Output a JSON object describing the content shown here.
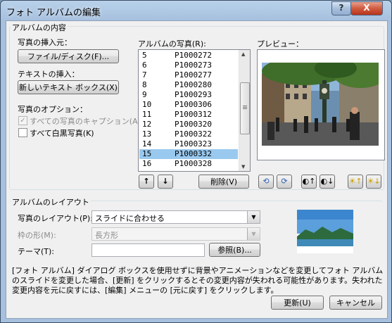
{
  "window": {
    "title": "フォト アルバムの編集",
    "help_label": "?",
    "close_label": "X"
  },
  "album_content": {
    "group_label": "アルバムの内容",
    "insert_photo_label": "写真の挿入元：",
    "file_disk_button": "ファイル/ディスク(F)...",
    "insert_text_label": "テキストの挿入：",
    "new_textbox_button": "新しいテキスト ボックス(X)",
    "photo_options_label": "写真のオプション：",
    "caption_all_label": "すべての写真のキャプション(A)",
    "caption_all_checked": true,
    "bw_all_label": "すべて白黒写真(K)",
    "bw_all_checked": false
  },
  "photo_list": {
    "label": "アルバムの写真(R):",
    "items": [
      {
        "num": "5",
        "name": "P1000272"
      },
      {
        "num": "6",
        "name": "P1000273"
      },
      {
        "num": "7",
        "name": "P1000277"
      },
      {
        "num": "8",
        "name": "P1000280"
      },
      {
        "num": "9",
        "name": "P1000293"
      },
      {
        "num": "10",
        "name": "P1000306"
      },
      {
        "num": "11",
        "name": "P1000312"
      },
      {
        "num": "12",
        "name": "P1000320"
      },
      {
        "num": "13",
        "name": "P1000322"
      },
      {
        "num": "14",
        "name": "P1000323"
      },
      {
        "num": "15",
        "name": "P1000332"
      },
      {
        "num": "16",
        "name": "P1000328"
      }
    ],
    "selected_index": 10,
    "move_up_icon": "↑",
    "move_down_icon": "↓",
    "delete_button": "削除(V)"
  },
  "preview": {
    "label": "プレビュー：",
    "tools": [
      "rotate-left-icon",
      "rotate-right-icon",
      "contrast-up-icon",
      "contrast-down-icon",
      "brightness-up-icon",
      "brightness-down-icon"
    ]
  },
  "layout": {
    "group_label": "アルバムのレイアウト",
    "picture_layout_label": "写真のレイアウト(P):",
    "picture_layout_value": "スライドに合わせる",
    "frame_shape_label": "枠の形(M):",
    "frame_shape_value": "長方形",
    "theme_label": "テーマ(T):",
    "theme_value": "",
    "browse_button": "参照(B)..."
  },
  "info_text": "[フォト アルバム] ダイアログ ボックスを使用せずに背景やアニメーションなどを変更してフォト アルバムのスライドを変更した場合、[更新] をクリックするとその変更内容が失われる可能性があります。失われた変更内容を元に戻すには、[編集] メニューの [元に戻す] をクリックします。",
  "footer": {
    "update_button": "更新(U)",
    "cancel_button": "キャンセル"
  }
}
